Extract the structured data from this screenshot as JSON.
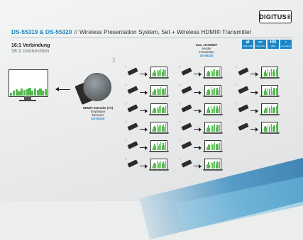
{
  "logo": {
    "text": "DIGITUS®"
  },
  "header": {
    "models": "DS-55319 & DS-55320",
    "separator": "//",
    "title": "Wireless Presentation System, Set + Wireless HDMI® Transmitter"
  },
  "subtitle": {
    "line1": "16:1 Verbindung",
    "line2": "16:1 connection"
  },
  "feature_icons": [
    {
      "name": "usb-icon",
      "glyph": "⇄",
      "label": "HDMI+USB"
    },
    {
      "name": "screen-icon",
      "glyph": "▭",
      "label": "Plug & Play"
    },
    {
      "name": "hd-icon",
      "glyph": "HD",
      "label": "1080p"
    },
    {
      "name": "arrow-icon",
      "glyph": "›",
      "label": "Long Range"
    }
  ],
  "receiver": {
    "line1": "HDMI® Extender (TX)",
    "line2": "Empfänger",
    "line3": "Receiver",
    "model": "DS-55319"
  },
  "sender": {
    "line1": "max. 16 HDMI®",
    "line2": "Sender",
    "line3": "Transmitter",
    "model": "DS-55320"
  },
  "bar_values": [
    0.35,
    0.55,
    0.75,
    0.5,
    0.9,
    0.65,
    0.8,
    1.0,
    0.6,
    0.85,
    0.7,
    0.95
  ],
  "monitor_bars": [
    0.4,
    0.6,
    0.8,
    0.55,
    0.95,
    0.7,
    0.85,
    1.0,
    0.65,
    0.9,
    0.75,
    0.95,
    0.6,
    0.8
  ]
}
